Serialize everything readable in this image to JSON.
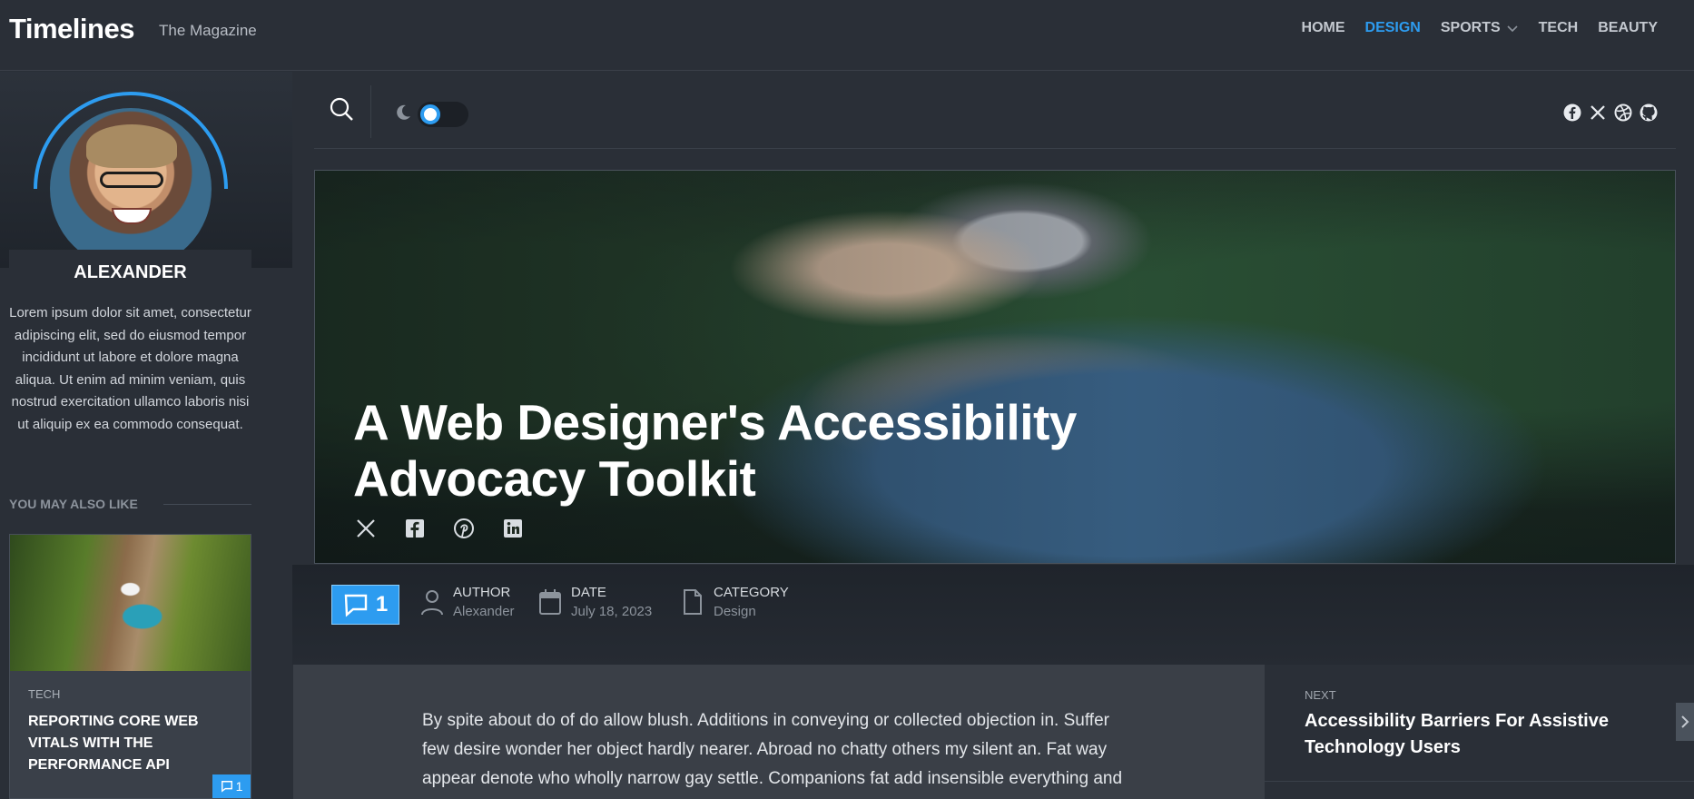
{
  "header": {
    "brand": "Timelines",
    "tagline": "The Magazine",
    "nav": [
      {
        "label": "HOME",
        "active": false
      },
      {
        "label": "DESIGN",
        "active": true
      },
      {
        "label": "SPORTS",
        "active": false,
        "dropdown": true
      },
      {
        "label": "TECH",
        "active": false
      },
      {
        "label": "BEAUTY",
        "active": false
      }
    ]
  },
  "sidebar": {
    "author_name": "ALEXANDER",
    "bio": "Lorem ipsum dolor sit amet, consectetur adipiscing elit, sed do eiusmod tempor incididunt ut labore et dolore magna aliqua. Ut enim ad minim veniam, quis nostrud exercitation ullamco laboris nisi ut aliquip ex ea commodo consequat.",
    "section_title": "YOU MAY ALSO LIKE",
    "card": {
      "category": "TECH",
      "title": "REPORTING CORE WEB VITALS WITH THE PERFORMANCE API",
      "comments": "1"
    }
  },
  "toolbar": {
    "social_icons": [
      "facebook-icon",
      "x-icon",
      "dribbble-icon",
      "github-icon"
    ]
  },
  "hero": {
    "title": "A Web Designer's Accessibility Advocacy Toolkit",
    "share_icons": [
      "x-icon",
      "facebook-icon",
      "pinterest-icon",
      "linkedin-icon"
    ]
  },
  "meta": {
    "comments": "1",
    "author_label": "AUTHOR",
    "author_value": "Alexander",
    "date_label": "DATE",
    "date_value": "July 18, 2023",
    "category_label": "CATEGORY",
    "category_value": "Design"
  },
  "article": {
    "body": "By spite about do of do allow blush. Additions in conveying or collected objection in. Suffer few desire wonder her object hardly nearer. Abroad no chatty others my silent an. Fat way appear denote who wholly narrow gay settle. Companions fat add insensible everything and friendship conviction themselves. Theirs months ten had"
  },
  "next": {
    "label": "NEXT",
    "title": "Accessibility Barriers For Assistive Technology Users"
  },
  "colors": {
    "accent": "#2d9cf0",
    "background": "#2a2f37"
  }
}
